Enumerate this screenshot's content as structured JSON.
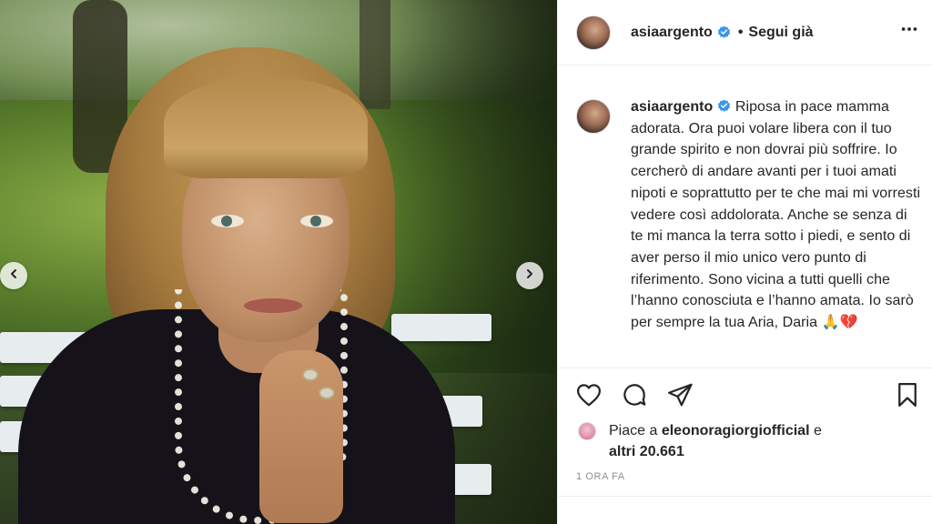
{
  "post": {
    "username": "asiaargento",
    "follow_label": "Segui già",
    "caption_text": "Riposa in pace mamma adorata. Ora puoi volare libera con il tuo grande spirito e non dovrai più soffrire. Io cercherò di andare avanti per i tuoi amati nipoti e soprattutto per te che mai mi vorresti vedere così addolorata. Anche se senza di te mi manca la terra sotto i piedi, e sento di aver perso il mio unico vero punto di riferimento. Sono vicina a tutti quelli che l’hanno conosciuta e l’hanno amata. Io sarò per sempre la tua Aria, Daria 🙏💔",
    "likes_prefix": "Piace a",
    "liker": "eleonoragiorgiofficial",
    "likes_conj": "e",
    "others_label": "altri 20.661",
    "timestamp": "1 ORA FA"
  },
  "icons": {
    "verified": "verified-badge-icon",
    "more": "more-options-icon",
    "like": "heart-icon",
    "comment": "comment-icon",
    "share": "share-icon",
    "save": "bookmark-icon",
    "prev": "chevron-left-icon",
    "next": "chevron-right-icon"
  },
  "colors": {
    "verified_blue": "#3897f0",
    "text": "#262626",
    "muted": "#8e8e8e",
    "divider": "#efefef"
  }
}
